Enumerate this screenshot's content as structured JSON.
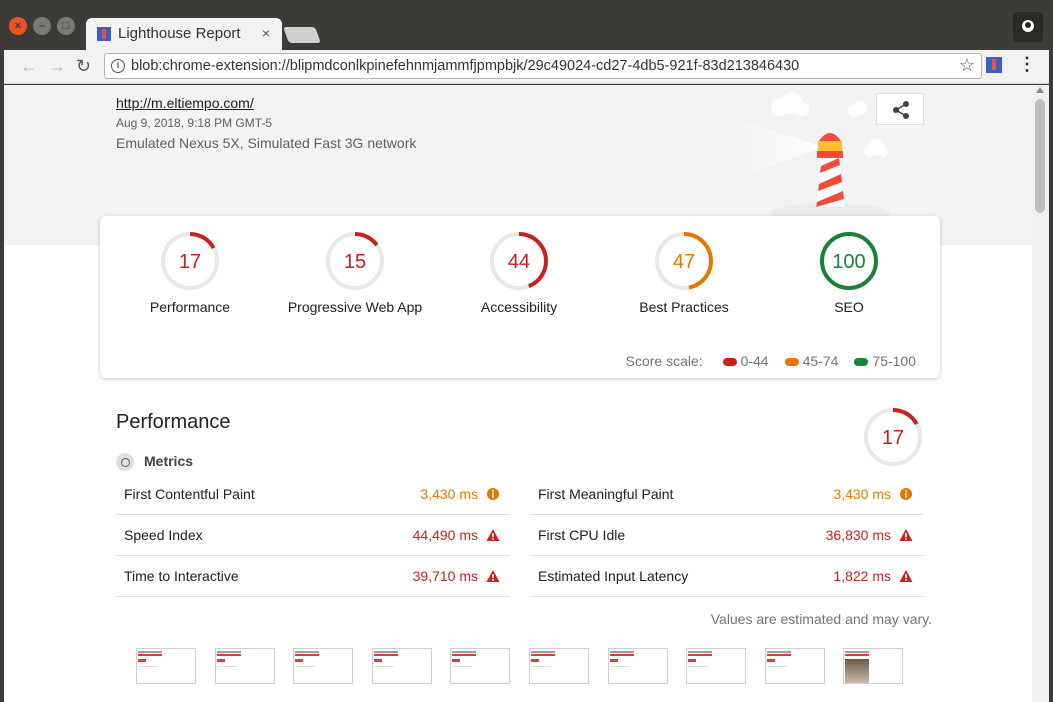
{
  "browser": {
    "window_buttons": {
      "close": "×",
      "minimize": "–",
      "maximize": "□"
    },
    "tab_title": "Lighthouse Report",
    "tab_close": "×",
    "url": "blob:chrome-extension://blipmdconlkpinefehnmjammfjpmpbjk/29c49024-cd27-4db5-921f-83d213846430"
  },
  "report": {
    "site_url": "http://m.eltiempo.com/",
    "date": "Aug 9, 2018, 9:18 PM GMT-5",
    "environment": "Emulated Nexus 5X, Simulated Fast 3G network"
  },
  "colors": {
    "fail": "#c7221f",
    "average": "#e67700",
    "pass": "#178239"
  },
  "gauges": [
    {
      "label": "Performance",
      "score": 17,
      "status": "fail"
    },
    {
      "label": "Progressive Web App",
      "score": 15,
      "status": "fail"
    },
    {
      "label": "Accessibility",
      "score": 44,
      "status": "fail"
    },
    {
      "label": "Best Practices",
      "score": 47,
      "status": "average"
    },
    {
      "label": "SEO",
      "score": 100,
      "status": "pass"
    }
  ],
  "score_scale": {
    "label": "Score scale:",
    "ranges": [
      {
        "label": "0-44",
        "status": "fail"
      },
      {
        "label": "45-74",
        "status": "average"
      },
      {
        "label": "75-100",
        "status": "pass"
      }
    ]
  },
  "performance": {
    "title": "Performance",
    "score": 17,
    "metrics_label": "Metrics",
    "metrics": [
      {
        "name": "First Contentful Paint",
        "value": "3,430 ms",
        "status": "average"
      },
      {
        "name": "First Meaningful Paint",
        "value": "3,430 ms",
        "status": "average"
      },
      {
        "name": "Speed Index",
        "value": "44,490 ms",
        "status": "fail"
      },
      {
        "name": "First CPU Idle",
        "value": "36,830 ms",
        "status": "fail"
      },
      {
        "name": "Time to Interactive",
        "value": "39,710 ms",
        "status": "fail"
      },
      {
        "name": "Estimated Input Latency",
        "value": "1,822 ms",
        "status": "fail"
      }
    ],
    "note": "Values are estimated and may vary.",
    "filmstrip_count": 10
  }
}
